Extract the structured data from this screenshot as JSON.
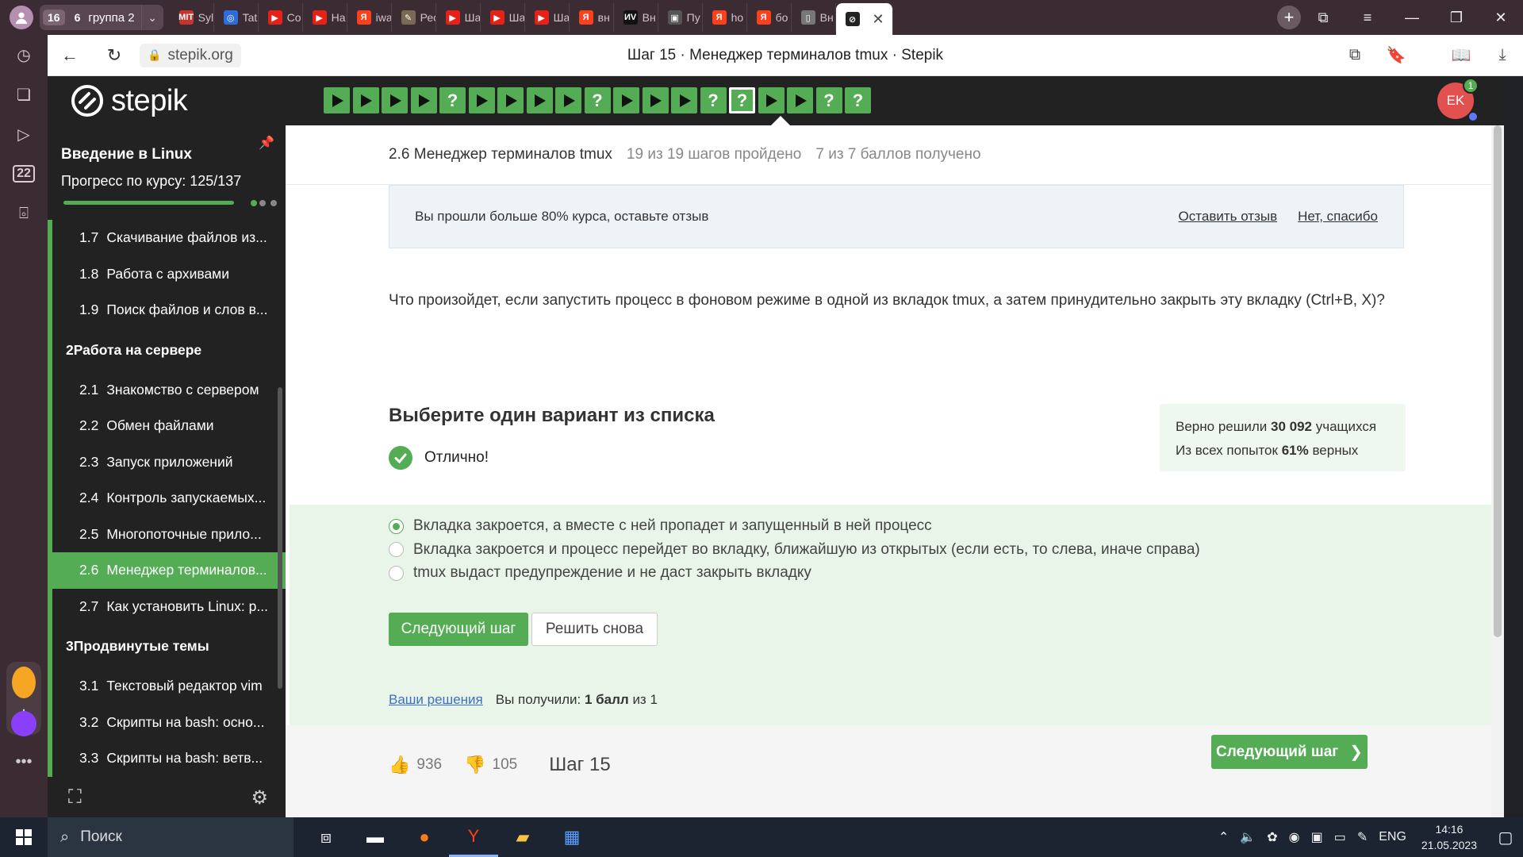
{
  "browser": {
    "tab_count": "16",
    "group_count": "6",
    "group_name": "группа 2",
    "tabs": [
      {
        "label": "Syl",
        "color": "#c8332b",
        "glyph": "MIT"
      },
      {
        "label": "Tat",
        "color": "#2d6cdf",
        "glyph": "◎"
      },
      {
        "label": "Co",
        "color": "#e62117",
        "glyph": "▶"
      },
      {
        "label": "Ha",
        "color": "#e62117",
        "glyph": "▶"
      },
      {
        "label": "iwa",
        "color": "#fc3f1d",
        "glyph": "Я"
      },
      {
        "label": "Рес",
        "color": "#7a6a55",
        "glyph": "✎"
      },
      {
        "label": "Ша",
        "color": "#e62117",
        "glyph": "▶"
      },
      {
        "label": "Ша",
        "color": "#e62117",
        "glyph": "▶"
      },
      {
        "label": "Ша",
        "color": "#e62117",
        "glyph": "▶"
      },
      {
        "label": "вн",
        "color": "#fc3f1d",
        "glyph": "Я"
      },
      {
        "label": "Вн",
        "color": "#111111",
        "glyph": "ИV"
      },
      {
        "label": "Пу",
        "color": "#555555",
        "glyph": "▣"
      },
      {
        "label": "ho",
        "color": "#fc3f1d",
        "glyph": "Я"
      },
      {
        "label": "бо",
        "color": "#fc3f1d",
        "glyph": "Я"
      },
      {
        "label": "Вн",
        "color": "#777777",
        "glyph": "▯"
      }
    ],
    "url": "stepik.org",
    "page_title": "Шаг 15 · Менеджер терминалов tmux · Stepik",
    "side_counter": "22"
  },
  "header": {
    "logo": "stepik",
    "steps": [
      "play",
      "play",
      "play",
      "play",
      "quiz",
      "play",
      "play",
      "play",
      "play",
      "quiz",
      "play",
      "play",
      "play",
      "quiz",
      "quiz-current",
      "play",
      "play",
      "quiz",
      "quiz"
    ],
    "avatar_initials": "EK",
    "notif_count": "1"
  },
  "sidebar": {
    "course_title": "Введение в Linux",
    "progress_label": "Прогресс по курсу:",
    "progress_value": "125/137",
    "progress_fraction": 0.912,
    "items": [
      {
        "type": "lesson",
        "num": "1.7",
        "title": "Скачивание файлов из..."
      },
      {
        "type": "lesson",
        "num": "1.8",
        "title": "Работа с архивами"
      },
      {
        "type": "lesson",
        "num": "1.9",
        "title": "Поиск файлов и слов в..."
      },
      {
        "type": "module",
        "num": "2",
        "title": "Работа на сервере"
      },
      {
        "type": "lesson",
        "num": "2.1",
        "title": "Знакомство с сервером"
      },
      {
        "type": "lesson",
        "num": "2.2",
        "title": "Обмен файлами"
      },
      {
        "type": "lesson",
        "num": "2.3",
        "title": "Запуск приложений"
      },
      {
        "type": "lesson",
        "num": "2.4",
        "title": "Контроль запускаемых..."
      },
      {
        "type": "lesson",
        "num": "2.5",
        "title": "Многопоточные прило..."
      },
      {
        "type": "lesson",
        "num": "2.6",
        "title": "Менеджер терминалов...",
        "active": true
      },
      {
        "type": "lesson",
        "num": "2.7",
        "title": "Как установить Linux: p..."
      },
      {
        "type": "module",
        "num": "3",
        "title": "Продвинутые темы"
      },
      {
        "type": "lesson",
        "num": "3.1",
        "title": "Текстовый редактор vim"
      },
      {
        "type": "lesson",
        "num": "3.2",
        "title": "Скрипты на bash: осно..."
      },
      {
        "type": "lesson",
        "num": "3.3",
        "title": "Скрипты на bash: ветв..."
      }
    ]
  },
  "lesson": {
    "title": "2.6 Менеджер терминалов tmux",
    "steps_done": "19 из 19 шагов пройдено",
    "points": "7 из 7 баллов  получено"
  },
  "feedback": {
    "text": "Вы прошли больше 80% курса, оставьте отзыв",
    "leave": "Оставить отзыв",
    "decline": "Нет, спасибо"
  },
  "question": "Что произойдет, если запустить процесс в фоновом режиме в одной из вкладок tmux, а затем принудительно закрыть эту вкладку (Ctrl+B, X)?",
  "quiz": {
    "heading": "Выберите один вариант из списка",
    "result": "Отлично!",
    "stats_solved_prefix": "Верно решили",
    "stats_solved_count": "30 092",
    "stats_solved_suffix": "учащихся",
    "stats_attempts_prefix": "Из всех попыток",
    "stats_attempts_pct": "61%",
    "stats_attempts_suffix": "верных",
    "options": [
      {
        "text": "Вкладка закроется, а вместе с ней пропадет и запущенный в ней процесс",
        "selected": true
      },
      {
        "text": "Вкладка закроется и процесс перейдет во вкладку, ближайшую из открытых (если есть, то слева, иначе справа)",
        "selected": false
      },
      {
        "text": "tmux выдаст предупреждение и не даст закрыть вкладку",
        "selected": false
      }
    ],
    "next_button": "Следующий шаг",
    "retry_button": "Решить снова",
    "solutions_link": "Ваши решения",
    "score_prefix": "Вы получили:",
    "score_value": "1 балл",
    "score_suffix": "из 1"
  },
  "footer": {
    "likes": "936",
    "dislikes": "105",
    "step_label": "Шаг 15",
    "next_button": "Следующий шаг"
  },
  "taskbar": {
    "search_placeholder": "Поиск",
    "lang": "ENG",
    "time": "14:16",
    "date": "21.05.2023"
  }
}
